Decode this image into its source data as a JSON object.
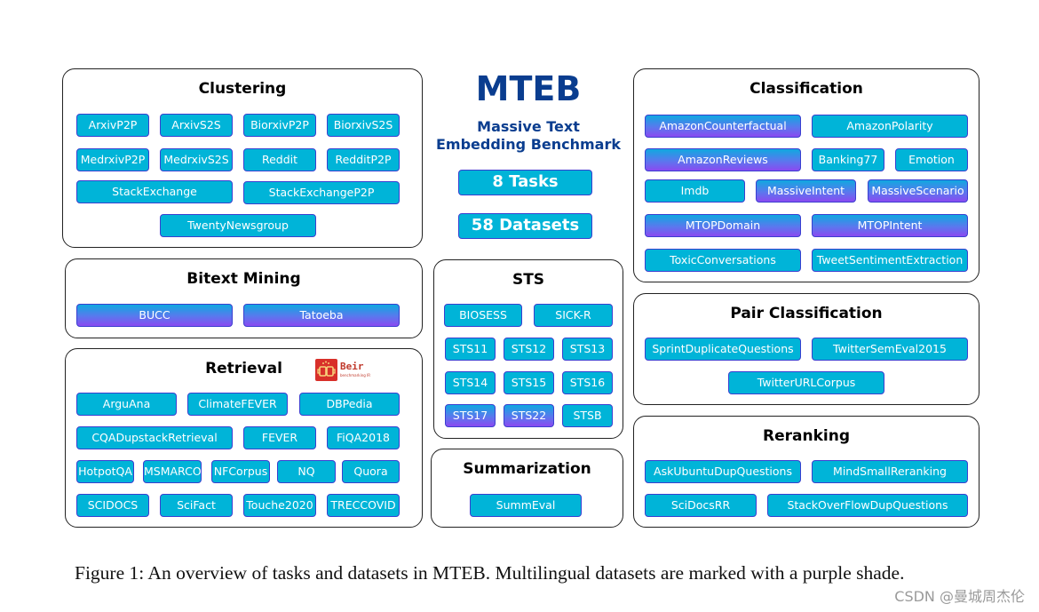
{
  "header": {
    "title": "MTEB",
    "subtitle_line1": "Massive Text",
    "subtitle_line2": "Embedding Benchmark",
    "tasks_label": "8 Tasks",
    "datasets_label": "58 Datasets"
  },
  "colors": {
    "monolingual": "#00b4d8",
    "multilingual_top": "#10a8e0",
    "multilingual_bottom": "#8a4af0",
    "title_blue": "#0a3d8f",
    "dataset_border": "#3a3fd0"
  },
  "tasks": {
    "clustering": {
      "title": "Clustering",
      "datasets": [
        {
          "name": "ArxivP2P",
          "multilingual": false
        },
        {
          "name": "ArxivS2S",
          "multilingual": false
        },
        {
          "name": "BiorxivP2P",
          "multilingual": false
        },
        {
          "name": "BiorxivS2S",
          "multilingual": false
        },
        {
          "name": "MedrxivP2P",
          "multilingual": false
        },
        {
          "name": "MedrxivS2S",
          "multilingual": false
        },
        {
          "name": "Reddit",
          "multilingual": false
        },
        {
          "name": "RedditP2P",
          "multilingual": false
        },
        {
          "name": "StackExchange",
          "multilingual": false
        },
        {
          "name": "StackExchangeP2P",
          "multilingual": false
        },
        {
          "name": "TwentyNewsgroup",
          "multilingual": false
        }
      ]
    },
    "bitext_mining": {
      "title": "Bitext Mining",
      "datasets": [
        {
          "name": "BUCC",
          "multilingual": true
        },
        {
          "name": "Tatoeba",
          "multilingual": true
        }
      ]
    },
    "retrieval": {
      "title": "Retrieval",
      "logo_text": "Beir",
      "logo_subtext": "benchmarking IR",
      "datasets": [
        {
          "name": "ArguAna",
          "multilingual": false
        },
        {
          "name": "ClimateFEVER",
          "multilingual": false
        },
        {
          "name": "DBPedia",
          "multilingual": false
        },
        {
          "name": "CQADupstackRetrieval",
          "multilingual": false
        },
        {
          "name": "FEVER",
          "multilingual": false
        },
        {
          "name": "FiQA2018",
          "multilingual": false
        },
        {
          "name": "HotpotQA",
          "multilingual": false
        },
        {
          "name": "MSMARCO",
          "multilingual": false
        },
        {
          "name": "NFCorpus",
          "multilingual": false
        },
        {
          "name": "NQ",
          "multilingual": false
        },
        {
          "name": "Quora",
          "multilingual": false
        },
        {
          "name": "SCIDOCS",
          "multilingual": false
        },
        {
          "name": "SciFact",
          "multilingual": false
        },
        {
          "name": "Touche2020",
          "multilingual": false
        },
        {
          "name": "TRECCOVID",
          "multilingual": false
        }
      ]
    },
    "sts": {
      "title": "STS",
      "datasets": [
        {
          "name": "BIOSESS",
          "multilingual": false
        },
        {
          "name": "SICK-R",
          "multilingual": false
        },
        {
          "name": "STS11",
          "multilingual": false
        },
        {
          "name": "STS12",
          "multilingual": false
        },
        {
          "name": "STS13",
          "multilingual": false
        },
        {
          "name": "STS14",
          "multilingual": false
        },
        {
          "name": "STS15",
          "multilingual": false
        },
        {
          "name": "STS16",
          "multilingual": false
        },
        {
          "name": "STS17",
          "multilingual": true
        },
        {
          "name": "STS22",
          "multilingual": true
        },
        {
          "name": "STSB",
          "multilingual": false
        }
      ]
    },
    "summarization": {
      "title": "Summarization",
      "datasets": [
        {
          "name": "SummEval",
          "multilingual": false
        }
      ]
    },
    "classification": {
      "title": "Classification",
      "datasets": [
        {
          "name": "AmazonCounterfactual",
          "multilingual": true
        },
        {
          "name": "AmazonPolarity",
          "multilingual": false
        },
        {
          "name": "AmazonReviews",
          "multilingual": true
        },
        {
          "name": "Banking77",
          "multilingual": false
        },
        {
          "name": "Emotion",
          "multilingual": false
        },
        {
          "name": "Imdb",
          "multilingual": false
        },
        {
          "name": "MassiveIntent",
          "multilingual": true
        },
        {
          "name": "MassiveScenario",
          "multilingual": true
        },
        {
          "name": "MTOPDomain",
          "multilingual": true
        },
        {
          "name": "MTOPIntent",
          "multilingual": true
        },
        {
          "name": "ToxicConversations",
          "multilingual": false
        },
        {
          "name": "TweetSentimentExtraction",
          "multilingual": false
        }
      ]
    },
    "pair_classification": {
      "title": "Pair Classification",
      "datasets": [
        {
          "name": "SprintDuplicateQuestions",
          "multilingual": false
        },
        {
          "name": "TwitterSemEval2015",
          "multilingual": false
        },
        {
          "name": "TwitterURLCorpus",
          "multilingual": false
        }
      ]
    },
    "reranking": {
      "title": "Reranking",
      "datasets": [
        {
          "name": "AskUbuntuDupQuestions",
          "multilingual": false
        },
        {
          "name": "MindSmallReranking",
          "multilingual": false
        },
        {
          "name": "SciDocsRR",
          "multilingual": false
        },
        {
          "name": "StackOverFlowDupQuestions",
          "multilingual": false
        }
      ]
    }
  },
  "caption": "Figure 1: An overview of tasks and datasets in MTEB. Multilingual datasets are marked with a purple shade.",
  "watermark": "CSDN @曼城周杰伦"
}
